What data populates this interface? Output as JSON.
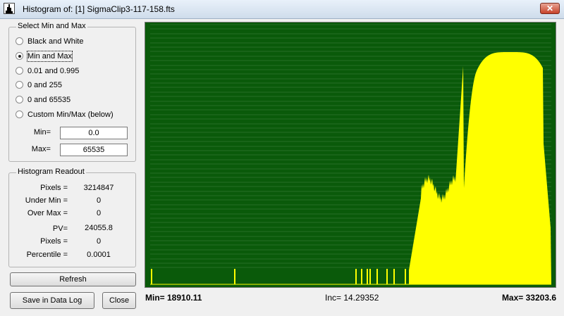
{
  "window": {
    "title": "Histogram of:  [1] SigmaClip3-117-158.fts",
    "close_glyph": "✕"
  },
  "select_group": {
    "title": "Select Min and Max",
    "options": [
      {
        "label": "Black and White",
        "checked": false
      },
      {
        "label": "Min and Max",
        "checked": true
      },
      {
        "label": "0.01 and 0.995",
        "checked": false
      },
      {
        "label": "0 and 255",
        "checked": false
      },
      {
        "label": "0 and 65535",
        "checked": false
      },
      {
        "label": "Custom Min/Max (below)",
        "checked": false
      }
    ],
    "min_label": "Min=",
    "min_value": "0.0",
    "max_label": "Max=",
    "max_value": "65535"
  },
  "readout_group": {
    "title": "Histogram Readout",
    "rows": [
      {
        "label": "Pixels =",
        "value": "3214847"
      },
      {
        "label": "Under Min =",
        "value": "0"
      },
      {
        "label": "Over Max =",
        "value": "0"
      },
      {
        "label": "PV=",
        "value": "24055.8"
      },
      {
        "label": "Pixels =",
        "value": "0"
      },
      {
        "label": "Percentile =",
        "value": "0.0001"
      }
    ]
  },
  "buttons": {
    "refresh": "Refresh",
    "save_log": "Save in Data Log",
    "close": "Close"
  },
  "status": {
    "min": "Min= 18910.11",
    "inc": "Inc= 14.29352",
    "max": "Max= 33203.6"
  },
  "colors": {
    "plot_bg": "#0a5a0a",
    "histogram": "#ffff00",
    "gridline": "#6fa86f"
  }
}
